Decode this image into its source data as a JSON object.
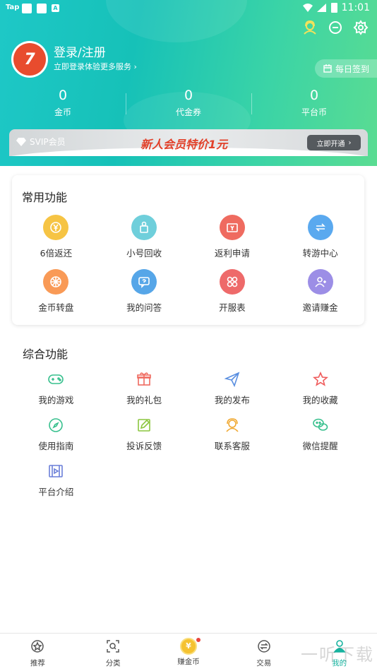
{
  "status_bar": {
    "carrier": "Tap",
    "badge": "A",
    "time": "11:01"
  },
  "header": {
    "login_title": "登录/注册",
    "login_subtitle": "立即登录体验更多服务 ›",
    "avatar_text": "7",
    "signin_label": "每日签到",
    "stats": [
      {
        "value": "0",
        "label": "金币"
      },
      {
        "value": "0",
        "label": "代金券"
      },
      {
        "value": "0",
        "label": "平台币"
      }
    ]
  },
  "svip": {
    "label": "SVIP会员",
    "promo": "新人会员特价1元",
    "button": "立即开通"
  },
  "common": {
    "title": "常用功能",
    "items": [
      {
        "label": "6倍返还",
        "icon": "yen-cycle-icon",
        "color": "#f6c444"
      },
      {
        "label": "小号回收",
        "icon": "recycle-icon",
        "color": "#6fcfdb"
      },
      {
        "label": "返利申请",
        "icon": "rebate-icon",
        "color": "#ef6b60"
      },
      {
        "label": "转游中心",
        "icon": "transfer-icon",
        "color": "#5aa9ef"
      },
      {
        "label": "金币转盘",
        "icon": "wheel-icon",
        "color": "#f99a56"
      },
      {
        "label": "我的问答",
        "icon": "qa-icon",
        "color": "#56a6e8"
      },
      {
        "label": "开服表",
        "icon": "server-icon",
        "color": "#ee6a6a"
      },
      {
        "label": "邀请赚金",
        "icon": "invite-icon",
        "color": "#9c8ee6"
      }
    ]
  },
  "composite": {
    "title": "综合功能",
    "items": [
      {
        "label": "我的游戏",
        "icon": "gamepad-icon",
        "color": "#38c08e"
      },
      {
        "label": "我的礼包",
        "icon": "gift-icon",
        "color": "#ef6b60"
      },
      {
        "label": "我的发布",
        "icon": "send-icon",
        "color": "#5a8fe0"
      },
      {
        "label": "我的收藏",
        "icon": "star-icon",
        "color": "#ef5b5b"
      },
      {
        "label": "使用指南",
        "icon": "compass-icon",
        "color": "#38c08e"
      },
      {
        "label": "投诉反馈",
        "icon": "edit-icon",
        "color": "#8cc63f"
      },
      {
        "label": "联系客服",
        "icon": "service-icon",
        "color": "#f0a830"
      },
      {
        "label": "微信提醒",
        "icon": "wechat-icon",
        "color": "#38c08e"
      },
      {
        "label": "平台介绍",
        "icon": "video-icon",
        "color": "#6a7fd8"
      }
    ]
  },
  "nav": {
    "items": [
      {
        "label": "推荐",
        "icon": "recommend-icon"
      },
      {
        "label": "分类",
        "icon": "category-icon"
      },
      {
        "label": "赚金币",
        "icon": "coin-icon",
        "coin_symbol": "¥"
      },
      {
        "label": "交易",
        "icon": "trade-icon"
      },
      {
        "label": "我的",
        "icon": "profile-icon"
      }
    ]
  },
  "watermark": "一听下载"
}
